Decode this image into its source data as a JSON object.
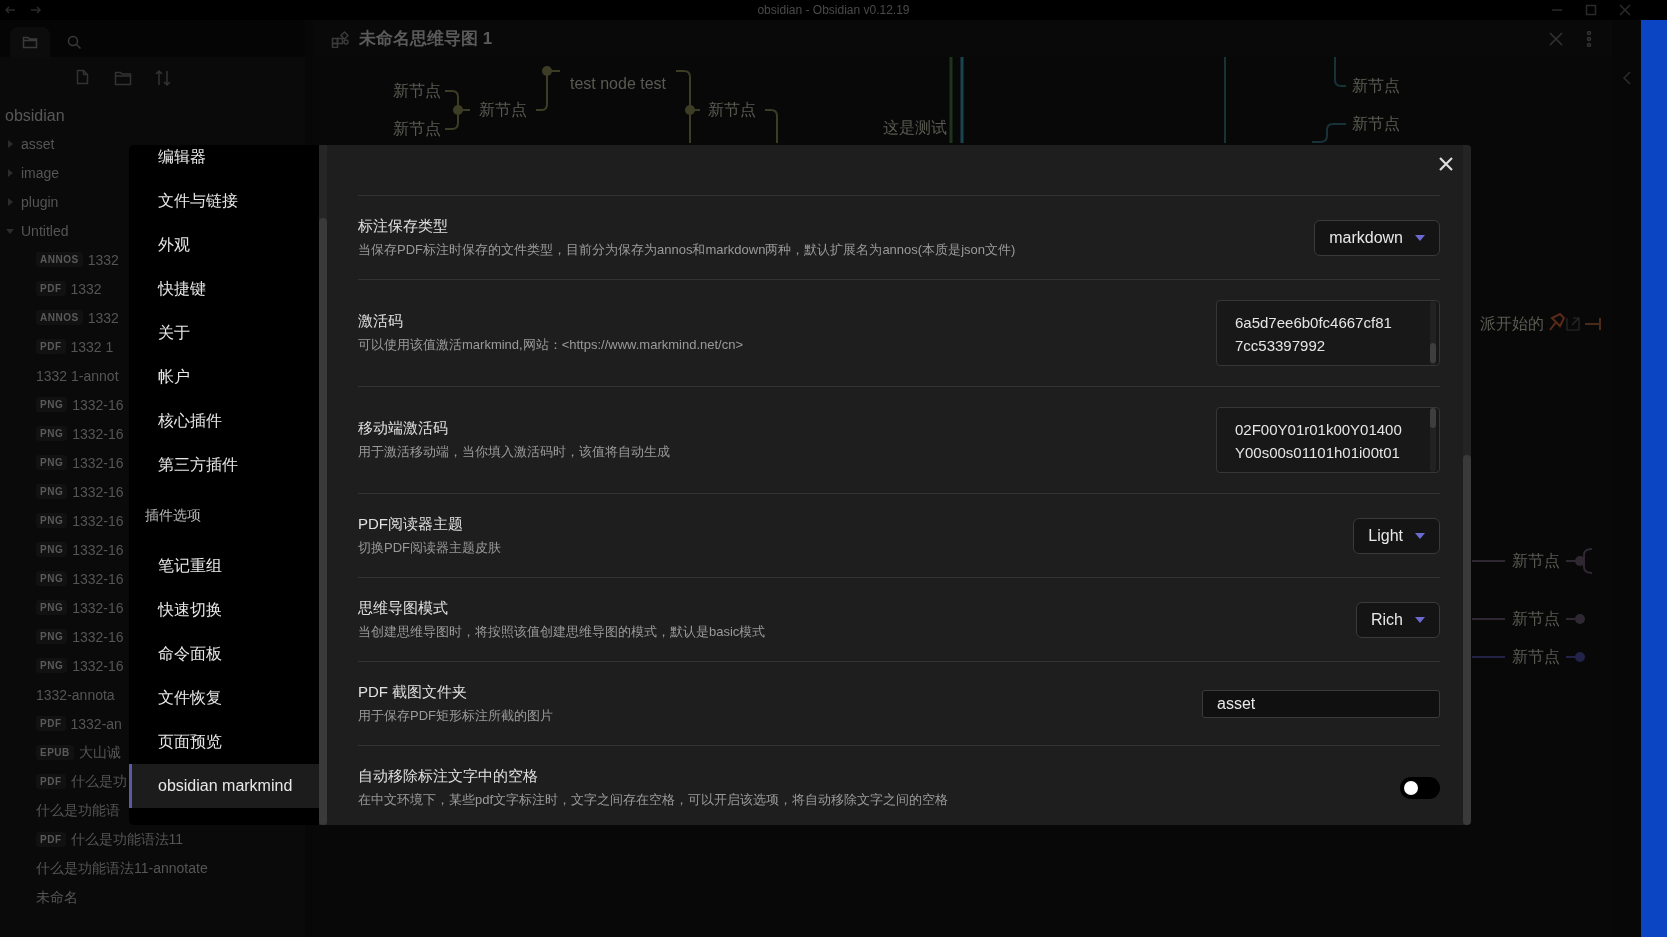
{
  "window": {
    "title": "obsidian - Obsidian v0.12.19"
  },
  "file_explorer": {
    "vault": "obsidian",
    "items": [
      {
        "label": "asset",
        "kind": "folder",
        "expanded": false
      },
      {
        "label": "image",
        "kind": "folder",
        "expanded": false
      },
      {
        "label": "plugin",
        "kind": "folder",
        "expanded": false
      },
      {
        "label": "Untitled",
        "kind": "folder",
        "expanded": true,
        "children": [
          {
            "label": "1332",
            "badge": "ANNOS"
          },
          {
            "label": "1332",
            "badge": "PDF"
          },
          {
            "label": "1332",
            "badge": "ANNOS"
          },
          {
            "label": "1332 1",
            "badge": "PDF"
          },
          {
            "label": "1332 1-annot"
          },
          {
            "label": "1332-16",
            "badge": "PNG"
          },
          {
            "label": "1332-16",
            "badge": "PNG"
          },
          {
            "label": "1332-16",
            "badge": "PNG"
          },
          {
            "label": "1332-16",
            "badge": "PNG"
          },
          {
            "label": "1332-16",
            "badge": "PNG"
          },
          {
            "label": "1332-16",
            "badge": "PNG"
          },
          {
            "label": "1332-16",
            "badge": "PNG"
          },
          {
            "label": "1332-16",
            "badge": "PNG"
          },
          {
            "label": "1332-16",
            "badge": "PNG"
          },
          {
            "label": "1332-16",
            "badge": "PNG"
          },
          {
            "label": "1332-annota"
          },
          {
            "label": "1332-an",
            "badge": "PDF"
          },
          {
            "label": "大山诚",
            "badge": "EPUB"
          },
          {
            "label": "什么是功",
            "badge": "PDF"
          },
          {
            "label": "什么是功能语"
          },
          {
            "label": "什么是功能语法11",
            "badge": "PDF"
          },
          {
            "label": "什么是功能语法11-annotate"
          },
          {
            "label": "未命名"
          }
        ]
      }
    ]
  },
  "editor_tab": {
    "title": "未命名思维导图 1"
  },
  "mindmap": {
    "nodes": [
      {
        "label": "新节点"
      },
      {
        "label": "新节点"
      },
      {
        "label": "新节点"
      },
      {
        "label": "test node test"
      },
      {
        "label": "新节点"
      },
      {
        "label": "这是测试"
      },
      {
        "label": "新节点"
      },
      {
        "label": "新节点"
      },
      {
        "label": "派开始的"
      },
      {
        "label": "新节点"
      },
      {
        "label": "新节点"
      },
      {
        "label": "新节点"
      }
    ]
  },
  "settings": {
    "nav": [
      {
        "kind": "item",
        "label": "编辑器",
        "selected": false
      },
      {
        "kind": "item",
        "label": "文件与链接",
        "selected": false
      },
      {
        "kind": "item",
        "label": "外观",
        "selected": false
      },
      {
        "kind": "item",
        "label": "快捷键",
        "selected": false
      },
      {
        "kind": "item",
        "label": "关于",
        "selected": false
      },
      {
        "kind": "item",
        "label": "帐户",
        "selected": false
      },
      {
        "kind": "item",
        "label": "核心插件",
        "selected": false
      },
      {
        "kind": "item",
        "label": "第三方插件",
        "selected": false
      },
      {
        "kind": "heading",
        "label": "插件选项"
      },
      {
        "kind": "item",
        "label": "笔记重组",
        "selected": false
      },
      {
        "kind": "item",
        "label": "快速切换",
        "selected": false
      },
      {
        "kind": "item",
        "label": "命令面板",
        "selected": false
      },
      {
        "kind": "item",
        "label": "文件恢复",
        "selected": false
      },
      {
        "kind": "item",
        "label": "页面预览",
        "selected": false
      },
      {
        "kind": "item",
        "label": "obsidian markmind",
        "selected": true
      }
    ],
    "options": [
      {
        "kind": "dropdown",
        "name": "标注保存类型",
        "description": "当保存PDF标注时保存的文件类型，目前分为保存为annos和markdown两种，默认扩展名为annos(本质是json文件)",
        "value": "markdown"
      },
      {
        "kind": "textarea",
        "name": "激活码",
        "description": "可以使用该值激活markmind,网站：<https://www.markmind.net/cn>",
        "value": "6a5d7ee6b0fc4667cf81\n7cc53397992"
      },
      {
        "kind": "textarea",
        "name": "移动端激活码",
        "description": "用于激活移动端，当你填入激活码时，该值将自动生成",
        "value": "02F00Y01r01k00Y01400\nY00s00s01101h01i00t01"
      },
      {
        "kind": "dropdown",
        "name": "PDF阅读器主题",
        "description": "切换PDF阅读器主题皮肤",
        "value": "Light"
      },
      {
        "kind": "dropdown",
        "name": "思维导图模式",
        "description": "当创建思维导图时，将按照该值创建思维导图的模式，默认是basic模式",
        "value": "Rich"
      },
      {
        "kind": "text",
        "name": "PDF 截图文件夹",
        "description": "用于保存PDF矩形标注所截的图片",
        "value": "asset"
      },
      {
        "kind": "toggle",
        "name": "自动移除标注文字中的空格",
        "description": "在中文环境下，某些pdf文字标注时，文字之间存在空格，可以开启该选项，将自动移除文字之间的空格",
        "on": false
      }
    ]
  }
}
